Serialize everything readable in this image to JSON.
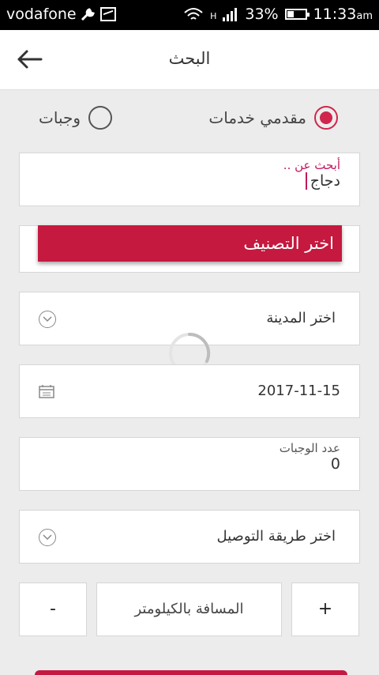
{
  "status_bar": {
    "carrier": "vodafone",
    "network_type": "H",
    "battery": "33%",
    "time": "11:33",
    "time_suffix": "am"
  },
  "header": {
    "title": "البحث",
    "back_icon": "back-arrow-icon"
  },
  "search_type": {
    "options": [
      {
        "label": "مقدمي خدمات",
        "selected": true
      },
      {
        "label": "وجبات",
        "selected": false
      }
    ]
  },
  "search": {
    "label": "أبحث عن ..",
    "value": "دجاج"
  },
  "category": {
    "label": "اختر التصنيف"
  },
  "city": {
    "label": "اختر المدينة"
  },
  "date": {
    "value": "2017-11-15"
  },
  "meals": {
    "label": "عدد الوجبات",
    "value": "0"
  },
  "delivery": {
    "label": "اختر طريقة التوصيل"
  },
  "distance": {
    "minus": "-",
    "placeholder": "المسافة بالكيلومتر",
    "plus": "+"
  },
  "colors": {
    "accent": "#c5193f",
    "background": "#ececec"
  }
}
